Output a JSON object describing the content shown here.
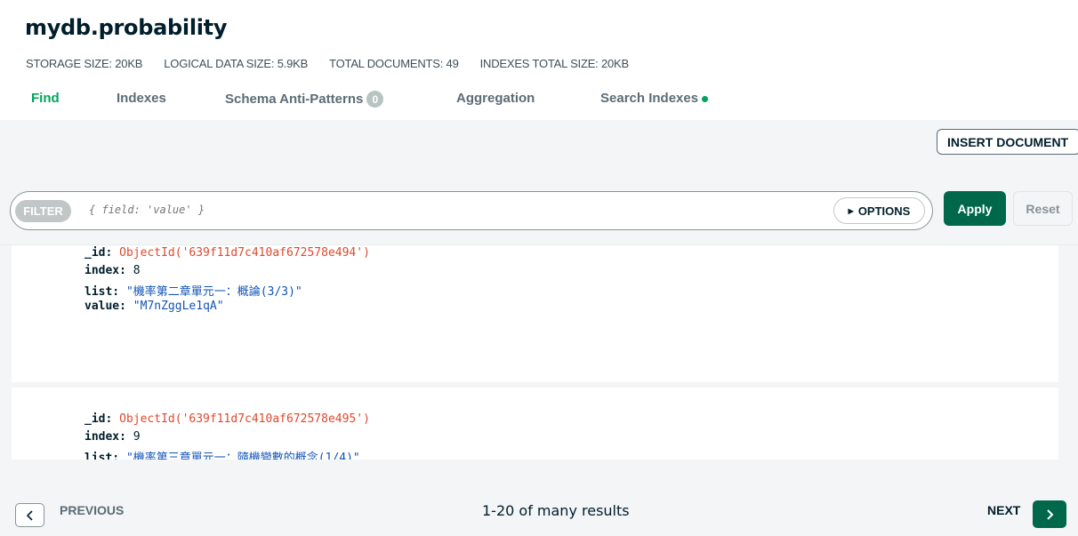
{
  "collection": {
    "title": "mydb.probability"
  },
  "stats": [
    {
      "label": "STORAGE SIZE: 20KB"
    },
    {
      "label": "LOGICAL DATA SIZE: 5.9KB"
    },
    {
      "label": "TOTAL DOCUMENTS: 49"
    },
    {
      "label": "INDEXES TOTAL SIZE: 20KB"
    }
  ],
  "tabs": {
    "find": "Find",
    "indexes": "Indexes",
    "schema": "Schema Anti-Patterns",
    "schema_badge": "0",
    "aggregation": "Aggregation",
    "search": "Search Indexes"
  },
  "toolbar": {
    "insert_label": "INSERT DOCUMENT",
    "filter_label": "FILTER",
    "filter_placeholder": "{ field: 'value' }",
    "options_label": "OPTIONS",
    "apply_label": "Apply",
    "reset_label": "Reset"
  },
  "documents": [
    {
      "id_key": "_id:",
      "id_value": "ObjectId('639f11d7c410af672578e494')",
      "index_key": "index:",
      "index_value": "8",
      "list_key": "list:",
      "list_value": "\"機率第二章單元一：概論(3/3)\"",
      "value_key": "value:",
      "value_value": "\"M7nZggLe1qA\""
    },
    {
      "id_key": "_id:",
      "id_value": "ObjectId('639f11d7c410af672578e495')",
      "index_key": "index:",
      "index_value": "9",
      "list_key": "list:",
      "list_value": "\"機率第三章單元一：隨機變數的概念(1/4)\""
    }
  ],
  "pagination": {
    "previous_label": "PREVIOUS",
    "summary": "1-20 of many results",
    "next_label": "NEXT"
  },
  "colors": {
    "accent_green": "#00a35c",
    "button_green": "#00684a",
    "objectid_red": "#e0482e",
    "string_blue": "#1254b7"
  }
}
